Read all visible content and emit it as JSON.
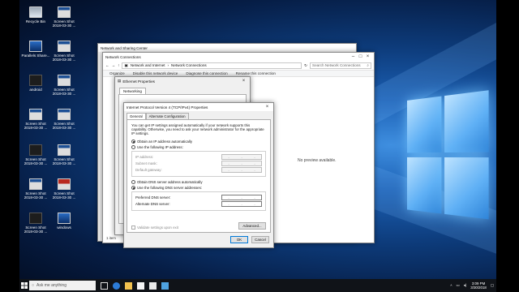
{
  "desktop": {
    "icons": [
      {
        "label": "Recycle Bin",
        "style": "bin"
      },
      {
        "label": "Screen Shot 2018-03-30 ...",
        "style": "shot"
      },
      {
        "label": "Parallels Share...",
        "style": "blue"
      },
      {
        "label": "Screen Shot 2018-03-30 ...",
        "style": "shot"
      },
      {
        "label": "android",
        "style": "dark"
      },
      {
        "label": "Screen Shot 2018-03-30 ...",
        "style": "shot"
      },
      {
        "label": "Screen Shot 2018-03-30 ...",
        "style": "shot"
      },
      {
        "label": "Screen Shot 2018-03-30 ...",
        "style": "shot"
      },
      {
        "label": "Screen Shot 2018-03-30 ...",
        "style": "dark"
      },
      {
        "label": "Screen Shot 2018-03-30 ...",
        "style": "shot"
      },
      {
        "label": "Screen Shot 2018-03-30 ...",
        "style": "shot"
      },
      {
        "label": "Screen Shot 2018-03-30 ...",
        "style": "red"
      },
      {
        "label": "Screen Shot 2018-03-30 ...",
        "style": "dark"
      },
      {
        "label": "windows",
        "style": "blue"
      }
    ]
  },
  "network_sharing_center": {
    "title": "Network and Sharing Center"
  },
  "network_connections": {
    "title": "Network Connections",
    "breadcrumb": [
      "Network and Internet",
      "Network Connections"
    ],
    "search_placeholder": "Search Network Connections",
    "commands": [
      "Organize",
      "Disable this network device",
      "Diagnose this connection",
      "Rename this connection"
    ],
    "no_preview": "No preview available.",
    "status": "1 item"
  },
  "ethernet_properties": {
    "title": "Ethernet Properties",
    "tab": "Networking"
  },
  "ipv4_dialog": {
    "title": "Internet Protocol Version 4 (TCP/IPv4) Properties",
    "tabs": [
      "General",
      "Alternate Configuration"
    ],
    "description": "You can get IP settings assigned automatically if your network supports this capability. Otherwise, you need to ask your network administrator for the appropriate IP settings.",
    "ip_auto": "Obtain an IP address automatically",
    "ip_manual": "Use the following IP address:",
    "ip_fields": [
      "IP address:",
      "Subnet mask:",
      "Default gateway:"
    ],
    "dns_auto": "Obtain DNS server address automatically",
    "dns_manual": "Use the following DNS server addresses:",
    "dns_fields": [
      "Preferred DNS server:",
      "Alternate DNS server:"
    ],
    "validate": "Validate settings upon exit",
    "advanced": "Advanced...",
    "ok": "OK",
    "cancel": "Cancel",
    "selected_ip_option": "auto",
    "selected_dns_option": "manual"
  },
  "taskbar": {
    "search_placeholder": "Ask me anything",
    "time": "3:09 PM",
    "date": "3/30/2018"
  }
}
